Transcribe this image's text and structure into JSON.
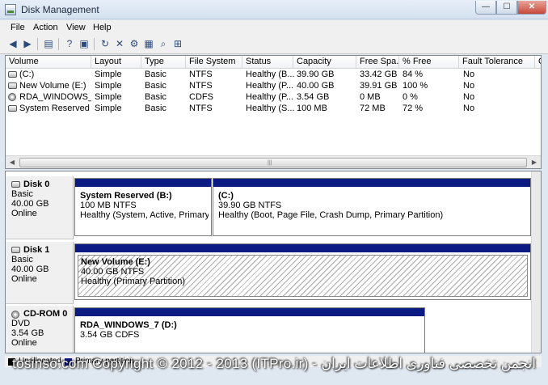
{
  "window": {
    "title": "Disk Management",
    "minimize": "—",
    "maximize": "☐",
    "close": "✕"
  },
  "menu": [
    "File",
    "Action",
    "View",
    "Help"
  ],
  "toolbar": {
    "icons": [
      "back-icon",
      "forward-icon",
      "console-tree-icon",
      "help-icon",
      "properties-icon",
      "refresh-icon",
      "delete-icon",
      "settings-icon",
      "open-icon",
      "search-icon",
      "export-icon"
    ]
  },
  "volume_table": {
    "columns": [
      "Volume",
      "Layout",
      "Type",
      "File System",
      "Status",
      "Capacity",
      "Free Spa...",
      "% Free",
      "Fault Tolerance",
      "O"
    ],
    "rows": [
      {
        "volume": "(C:)",
        "layout": "Simple",
        "type": "Basic",
        "fs": "NTFS",
        "status": "Healthy (B...",
        "capacity": "39.90 GB",
        "free": "33.42 GB",
        "pct": "84 %",
        "fault": "No",
        "icon": "volume-icon"
      },
      {
        "volume": "New Volume (E:)",
        "layout": "Simple",
        "type": "Basic",
        "fs": "NTFS",
        "status": "Healthy (P...",
        "capacity": "40.00 GB",
        "free": "39.91 GB",
        "pct": "100 %",
        "fault": "No",
        "icon": "volume-icon"
      },
      {
        "volume": "RDA_WINDOWS_7...",
        "layout": "Simple",
        "type": "Basic",
        "fs": "CDFS",
        "status": "Healthy (P...",
        "capacity": "3.54 GB",
        "free": "0 MB",
        "pct": "0 %",
        "fault": "No",
        "icon": "cd-icon"
      },
      {
        "volume": "System Reserved (...",
        "layout": "Simple",
        "type": "Basic",
        "fs": "NTFS",
        "status": "Healthy (S...",
        "capacity": "100 MB",
        "free": "72 MB",
        "pct": "72 %",
        "fault": "No",
        "icon": "volume-icon"
      }
    ]
  },
  "disks": [
    {
      "name": "Disk 0",
      "type": "Basic",
      "size": "40.00 GB",
      "state": "Online",
      "partitions": [
        {
          "name": "System Reserved  (B:)",
          "size": "100 MB NTFS",
          "status": "Healthy (System, Active, Primary Partition)"
        },
        {
          "name": "(C:)",
          "size": "39.90 GB NTFS",
          "status": "Healthy (Boot, Page File, Crash Dump, Primary Partition)"
        }
      ]
    },
    {
      "name": "Disk 1",
      "type": "Basic",
      "size": "40.00 GB",
      "state": "Online",
      "partitions": [
        {
          "name": "New Volume  (E:)",
          "size": "40.00 GB NTFS",
          "status": "Healthy (Primary Partition)"
        }
      ]
    },
    {
      "name": "CD-ROM 0",
      "type": "DVD",
      "size": "3.54 GB",
      "state": "Online",
      "partitions": [
        {
          "name": "RDA_WINDOWS_7  (D:)",
          "size": "3.54 GB CDFS",
          "status": ""
        }
      ]
    }
  ],
  "legend": {
    "unallocated": "Unallocated",
    "primary": "Primary partition",
    "unallocated_color": "#000000",
    "primary_color": "#0c1a84"
  },
  "watermark": "tosinso.com  Copyright © 2012 - 2013 (ITPro.ir) - انجمن تخصصی فناوری اطلاعات ایران"
}
